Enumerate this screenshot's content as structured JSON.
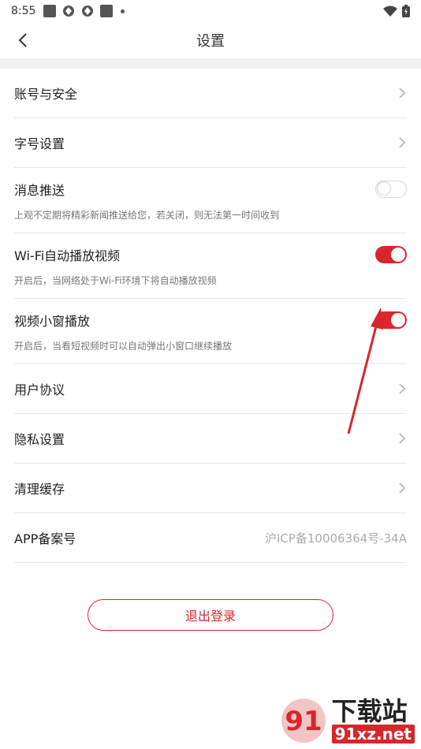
{
  "status_bar": {
    "time": "8:55"
  },
  "header": {
    "title": "设置"
  },
  "settings": [
    {
      "label": "账号与安全"
    },
    {
      "label": "字号设置"
    },
    {
      "label": "消息推送",
      "desc": "上观不定期将精彩新闻推送给您，若关闭，则无法第一时间收到",
      "toggle": false
    },
    {
      "label": "Wi-Fi自动播放视频",
      "desc": "开启后，当网络处于Wi-Fi环境下将自动播放视频",
      "toggle": true
    },
    {
      "label": "视频小窗播放",
      "desc": "开启后，当看短视频时可以自动弹出小窗口继续播放",
      "toggle": true
    },
    {
      "label": "用户协议"
    },
    {
      "label": "隐私设置"
    },
    {
      "label": "清理缓存"
    },
    {
      "label": "APP备案号",
      "value": "沪ICP备10006364号-34A"
    }
  ],
  "logout": {
    "label": "退出登录"
  },
  "watermark": {
    "big": "下载站",
    "small": "91xz.net",
    "logo": "91"
  },
  "colors": {
    "accent": "#d8262a",
    "divider": "#e6e6e6",
    "band": "#f1f1f1"
  }
}
